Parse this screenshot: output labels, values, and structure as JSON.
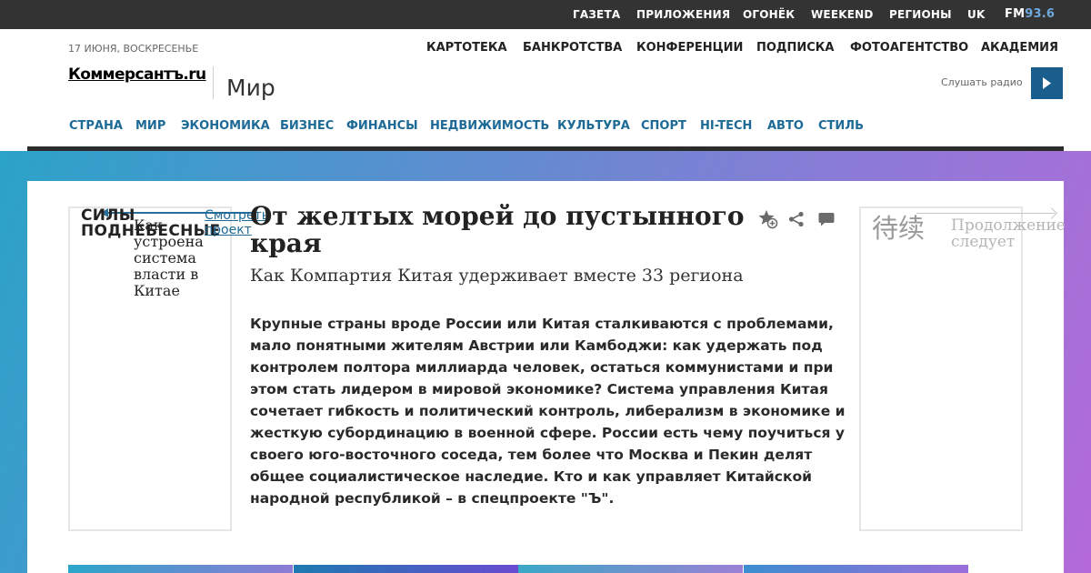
{
  "topbar": {
    "links": [
      "ГАЗЕТА",
      "ПРИЛОЖЕНИЯ",
      "ОГОНЁК",
      "WEEKEND",
      "РЕГИОНЫ",
      "UK"
    ],
    "fm_prefix": "FM",
    "fm_freq": "93.6"
  },
  "header": {
    "date": "17 ИЮНЯ, ВОСКРЕСЕНЬЕ",
    "secondary_links": [
      "КАРТОТЕКА",
      "БАНКРОТСТВА",
      "КОНФЕРЕНЦИИ",
      "ПОДПИСКА",
      "ФОТОАГЕНТСТВО",
      "АКАДЕМИЯ"
    ],
    "logo": "Коммерсантъ.ru",
    "section": "Мир",
    "radio_label": "Слушать радио",
    "radio_icon": "play-icon"
  },
  "mainnav": [
    "СТРАНА",
    "МИР",
    "ЭКОНОМИКА",
    "БИЗНЕС",
    "ФИНАНСЫ",
    "НЕДВИЖИМОСТЬ",
    "КУЛЬТУРА",
    "СПОРТ",
    "HI-TECH",
    "АВТО",
    "СТИЛЬ"
  ],
  "left_box": {
    "title": "СИЛЫ ПОДНЕБЕСНЫЕ",
    "link": "Смотреть проект",
    "text": "Как устроена система власти в Китае"
  },
  "right_box": {
    "chinese": "待续",
    "text": "Продолжение следует"
  },
  "article": {
    "title": "От желтых морей до пустынного края",
    "subtitle": "Как Компартия Китая удерживает вместе 33 региона",
    "lead": "Крупные страны вроде России или Китая сталкиваются с проблемами, мало понятными жителям Австрии или Камбоджи: как удержать под контролем полтора миллиарда человек, остаться коммунистами и при этом стать лидером в мировой экономике? Система управления Китая сочетает гибкость и политический контроль, либерализм в экономике и жесткую субординацию в военной сфере. России есть чему поучиться у своего юго-восточного соседа, тем более что Москва и Пекин делят общее социалистическое наследие. Кто и как управляет Китайской народной республикой – в спецпроекте \"Ъ\".",
    "icons": [
      "favorite-add-icon",
      "share-icon",
      "comment-icon"
    ]
  },
  "colors": {
    "topbar_bg": "#333333",
    "nav_link": "#1d6a96",
    "radio_button": "#1a5e8e",
    "gradient_start": "#2ba3c8",
    "gradient_end": "#b46ad8"
  }
}
